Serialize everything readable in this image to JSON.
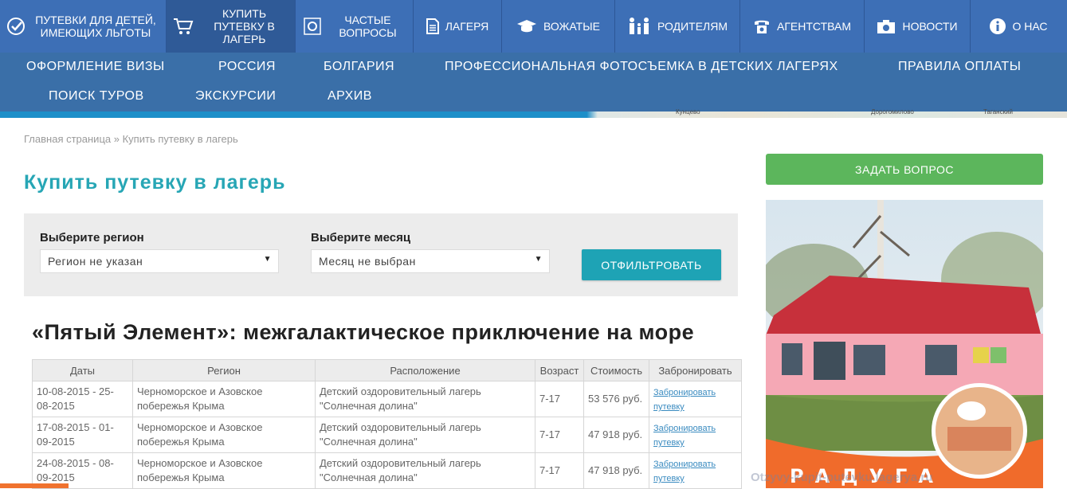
{
  "topnav": [
    {
      "label": "Путевки для детей, имеющих льготы",
      "icon": "check-circle-icon"
    },
    {
      "label": "Купить путевку в лагерь",
      "icon": "cart-icon"
    },
    {
      "label": "Частые вопросы",
      "icon": "sun-icon"
    },
    {
      "label": "Лагеря",
      "icon": "document-icon"
    },
    {
      "label": "Вожатые",
      "icon": "graduation-cap-icon"
    },
    {
      "label": "Родителям",
      "icon": "family-icon"
    },
    {
      "label": "Агентствам",
      "icon": "phone-icon"
    },
    {
      "label": "Новости",
      "icon": "camera-icon"
    },
    {
      "label": "О нас",
      "icon": "info-icon"
    }
  ],
  "subnav": [
    "ОФОРМЛЕНИЕ ВИЗЫ",
    "РОССИЯ",
    "БОЛГАРИЯ",
    "ПРОФЕССИОНАЛЬНАЯ ФОТОСЪЕМКА В ДЕТСКИХ ЛАГЕРЯХ",
    "ПРАВИЛА ОПЛАТЫ",
    "ПОИСК ТУРОВ",
    "ЭКСКУРСИИ",
    "АРХИВ"
  ],
  "map_labels": [
    "Кунцево",
    "Дорогомилово",
    "Таганский"
  ],
  "breadcrumb": {
    "home": "Главная страница",
    "separator": "»",
    "current": "Купить путевку в лагерь"
  },
  "page_title": "Купить путевку в лагерь",
  "filter": {
    "region_label": "Выберите регион",
    "region_value": "Регион не указан",
    "month_label": "Выберите месяц",
    "month_value": "Месяц не выбран",
    "button": "Отфильтровать"
  },
  "camp_title": "«Пятый Элемент»: межгалактическое приключение на море",
  "table": {
    "headers": [
      "Даты",
      "Регион",
      "Расположение",
      "Возраст",
      "Стоимость",
      "Забронировать"
    ],
    "rows": [
      {
        "dates": "10-08-2015 - 25-08-2015",
        "region": "Черноморское и Азовское побережья Крыма",
        "location": "Детский оздоровительный лагерь \"Солнечная долина\"",
        "age": "7-17",
        "price": "53 576 руб.",
        "link": "Забронировать путевку"
      },
      {
        "dates": "17-08-2015 - 01-09-2015",
        "region": "Черноморское и Азовское побережья Крыма",
        "location": "Детский оздоровительный лагерь \"Солнечная долина\"",
        "age": "7-17",
        "price": "47 918 руб.",
        "link": "Забронировать путевку"
      },
      {
        "dates": "24-08-2015 - 08-09-2015",
        "region": "Черноморское и Азовское побережья Крыма",
        "location": "Детский оздоровительный лагерь \"Солнечная долина\"",
        "age": "7-17",
        "price": "47 918 руб.",
        "link": "Забронировать путевку"
      }
    ]
  },
  "ask_button": "Задать вопрос",
  "promo_text": "РАДУГА",
  "watermark": "Otzyvy-kupit-putevku.lagerya.ru",
  "colors": {
    "nav": "#3d6fb6",
    "accent": "#27a6b5",
    "green": "#5cb65c",
    "orange": "#f06b2b"
  }
}
